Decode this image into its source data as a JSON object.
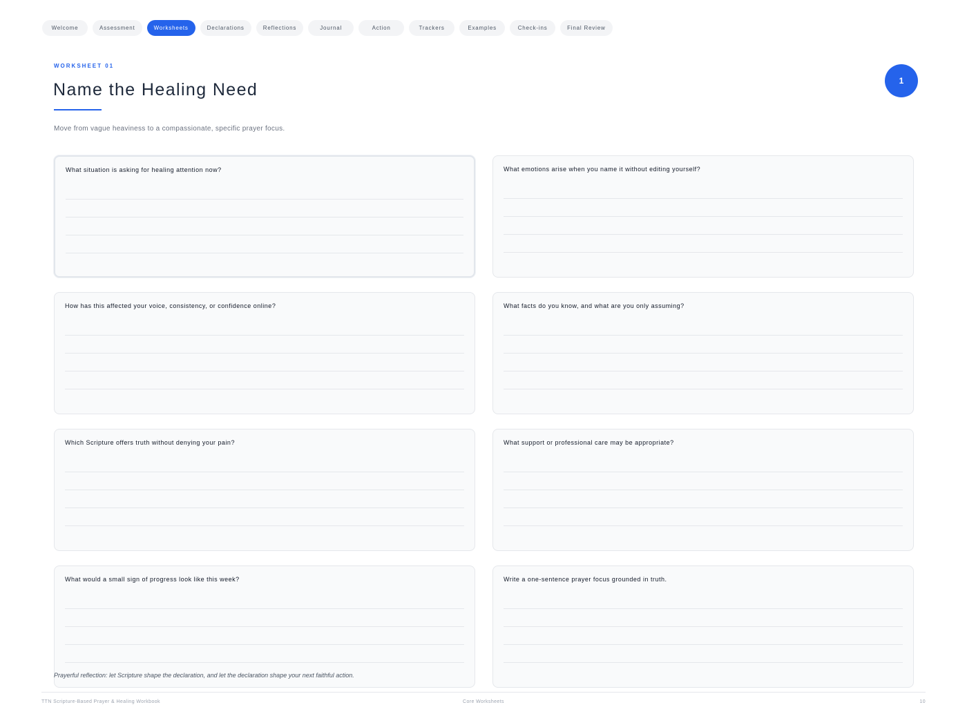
{
  "nav": {
    "tabs": [
      {
        "label": "Welcome"
      },
      {
        "label": "Assessment"
      },
      {
        "label": "Worksheets",
        "active": true
      },
      {
        "label": "Declarations"
      },
      {
        "label": "Reflections"
      },
      {
        "label": "Journal"
      },
      {
        "label": "Action"
      },
      {
        "label": "Trackers"
      },
      {
        "label": "Examples"
      },
      {
        "label": "Check-ins"
      },
      {
        "label": "Final Review"
      }
    ]
  },
  "header": {
    "eyebrow": "WORKSHEET 01",
    "title": "Name the Healing Need",
    "subtitle": "Move from vague heaviness to a compassionate, specific prayer focus.",
    "badge": "1"
  },
  "cards": [
    {
      "question": "What situation is asking for healing attention now?"
    },
    {
      "question": "What emotions arise when you name it without editing yourself?"
    },
    {
      "question": "How has this affected your voice, consistency, or confidence online?"
    },
    {
      "question": "What facts do you know, and what are you only assuming?"
    },
    {
      "question": "Which Scripture offers truth without denying your pain?"
    },
    {
      "question": "What support or professional care may be appropriate?"
    },
    {
      "question": "What would a small sign of progress look like this week?"
    },
    {
      "question": "Write a one-sentence prayer focus grounded in truth."
    }
  ],
  "reflection": "Prayerful reflection: let Scripture shape the declaration, and let the declaration shape your next faithful action.",
  "footer": {
    "left": "TTN Scripture-Based Prayer & Healing Workbook",
    "center": "Core Worksheets",
    "page": "10"
  },
  "colors": {
    "accent": "#2563eb",
    "card_bg": "#f9fafb",
    "card_border": "#e5e7eb"
  }
}
